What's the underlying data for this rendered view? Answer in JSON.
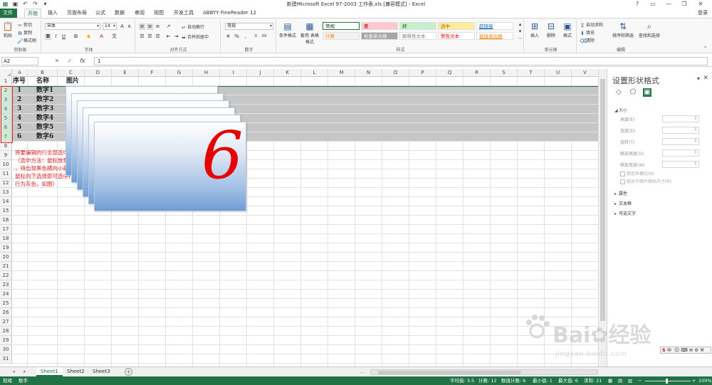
{
  "window": {
    "title": "新建Microsoft Excel 97-2003 工作表.xls [兼容模式] - Excel",
    "controls": [
      "?",
      "▭",
      "—",
      "❐",
      "✕"
    ]
  },
  "tabs": {
    "file": "文件",
    "items": [
      "开始",
      "插入",
      "页面布局",
      "公式",
      "数据",
      "审阅",
      "视图",
      "开发工具",
      "ABBYY FineReader 12"
    ],
    "active": "开始",
    "login": "登录"
  },
  "ribbon": {
    "clipboard": {
      "paste": "粘贴",
      "cut": "剪切",
      "copy": "复制",
      "format_painter": "格式刷",
      "label": "剪贴板"
    },
    "font": {
      "name": "宋体",
      "size": "14",
      "bold": "B",
      "italic": "I",
      "underline": "U",
      "label": "字体"
    },
    "alignment": {
      "wrap": "自动换行",
      "merge": "合并后居中",
      "label": "对齐方式"
    },
    "number": {
      "format": "常规",
      "percent": "%",
      "comma": ",",
      "label": "数字"
    },
    "styles": {
      "conditional": "条件格式",
      "table": "套用\n表格格式",
      "cells": [
        {
          "text": "常规",
          "bg": "#ffffff",
          "color": "#222222"
        },
        {
          "text": "差",
          "bg": "#ffc7ce",
          "color": "#9c0006"
        },
        {
          "text": "好",
          "bg": "#c6efce",
          "color": "#006100"
        },
        {
          "text": "适中",
          "bg": "#ffeb9c",
          "color": "#9c6500"
        },
        {
          "text": "超链接",
          "bg": "#ffffff",
          "color": "#0563c1"
        },
        {
          "text": "计算",
          "bg": "#f2f2f2",
          "color": "#fa7d00"
        },
        {
          "text": "检查单元格",
          "bg": "#a5a5a5",
          "color": "#ffffff"
        },
        {
          "text": "解释性文本",
          "bg": "#ffffff",
          "color": "#7f7f7f"
        },
        {
          "text": "警告文本",
          "bg": "#ffffff",
          "color": "#ff0000"
        },
        {
          "text": "链接单元格",
          "bg": "#ffffff",
          "color": "#fa7d00"
        }
      ],
      "label": "样式"
    },
    "cells_group": {
      "insert": "插入",
      "delete": "删除",
      "format": "格式",
      "label": "单元格"
    },
    "editing": {
      "autosum": "自动求和",
      "fill": "填充",
      "clear": "清除",
      "sort": "排序和筛选",
      "find": "查找和选择",
      "label": "编辑"
    }
  },
  "formula_bar": {
    "name_box": "A2",
    "cancel": "✕",
    "enter": "✓",
    "fx": "fx",
    "value": "1"
  },
  "grid": {
    "columns": [
      "A",
      "B",
      "C",
      "D",
      "E",
      "F",
      "G",
      "H",
      "I",
      "J",
      "K",
      "L",
      "M",
      "N",
      "O",
      "P",
      "Q",
      "R",
      "S",
      "T",
      "U",
      "V"
    ],
    "rows": [
      "1",
      "2",
      "3",
      "4",
      "5",
      "6",
      "7",
      "8",
      "9",
      "10",
      "11",
      "12",
      "13",
      "14",
      "15",
      "16",
      "17",
      "18",
      "19",
      "20",
      "21",
      "22",
      "23",
      "24",
      "25",
      "26",
      "27",
      "28",
      "29",
      "30",
      "31"
    ],
    "selected_rows": [
      "2",
      "3",
      "4",
      "5",
      "6",
      "7"
    ],
    "header": [
      "序号",
      "名称",
      "图片"
    ],
    "data": [
      [
        "1",
        "数字1"
      ],
      [
        "2",
        "数字2"
      ],
      [
        "3",
        "数字3"
      ],
      [
        "4",
        "数字4"
      ],
      [
        "5",
        "数字5"
      ],
      [
        "6",
        "数字6"
      ]
    ],
    "picture_number": "6",
    "annotation": [
      "将要编辑的行全部选中",
      "（选中方法：鼠标放到左侧数字栏",
      "，待出现黑色横向小箭头，点击拖动",
      "鼠标向下选择即可选中行，所选中的",
      "行为灰色，如图）"
    ]
  },
  "pane": {
    "title": "设置形状格式",
    "sections": {
      "size": "大小",
      "props": "属性",
      "textbox": "文本框",
      "alt_text": "可选文字"
    },
    "size_rows": [
      "高度(E)",
      "宽度(D)",
      "旋转(T)",
      "缩放高度(H)",
      "缩放宽度(W)"
    ],
    "checks": [
      "锁定纵横比(A)",
      "相对于图片原始尺寸(R)"
    ]
  },
  "sheets": {
    "tabs": [
      "Sheet1",
      "Sheet2",
      "Sheet3"
    ],
    "active": "Sheet1",
    "add": "+",
    "ellipsis": "..."
  },
  "status": {
    "ready": "就绪",
    "mode": "数字",
    "average": "平均值: 3.5",
    "count": "计数: 12",
    "numeric_count": "数值计数: 6",
    "min": "最小值: 1",
    "max": "最大值: 6",
    "sum": "求和: 21",
    "zoom": "100%"
  },
  "ime": "中",
  "watermark": {
    "brand": "Bai",
    "brand2": "经验",
    "url": "jingyan.baidu.com"
  }
}
